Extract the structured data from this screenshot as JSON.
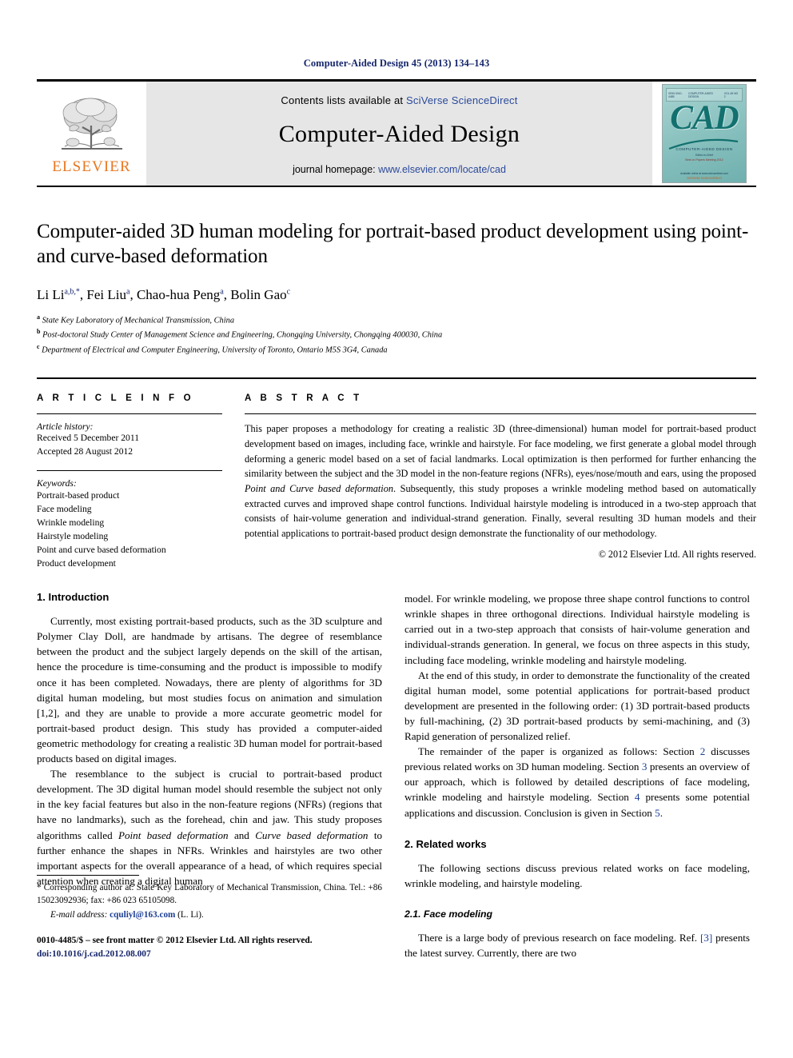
{
  "running_head": "Computer-Aided Design 45 (2013) 134–143",
  "masthead": {
    "contents_prefix": "Contents lists available at ",
    "contents_link": "SciVerse ScienceDirect",
    "journal_title": "Computer-Aided Design",
    "homepage_prefix": "journal homepage: ",
    "homepage_link": "www.elsevier.com/locate/cad",
    "publisher_logo_text": "ELSEVIER",
    "cover": {
      "title": "CAD",
      "top_left": "ISSN 0010-4485",
      "top_center": "COMPUTER-AIDED DESIGN",
      "top_right": "VOL 45 NO 2",
      "sub1": "COMPUTER-AIDED  DESIGN",
      "sub2": "Editor-in-Chief",
      "sub3": "Best on Papers Meeting 2012",
      "foot1": "Available online at www.sciencedirect.com",
      "foot2": "SciVerse ScienceDirect"
    }
  },
  "article": {
    "title": "Computer-aided 3D human modeling for portrait-based product development using point- and curve-based deformation",
    "authors": [
      {
        "name": "Li Li",
        "sup": "a,b,*"
      },
      {
        "name": "Fei Liu",
        "sup": "a"
      },
      {
        "name": "Chao-hua Peng",
        "sup": "a"
      },
      {
        "name": "Bolin Gao",
        "sup": "c"
      }
    ],
    "affiliations": [
      {
        "marker": "a",
        "text": "State Key Laboratory of Mechanical Transmission, China"
      },
      {
        "marker": "b",
        "text": "Post-doctoral Study Center of Management Science and Engineering, Chongqing University, Chongqing 400030, China"
      },
      {
        "marker": "c",
        "text": "Department of Electrical and Computer Engineering, University of Toronto, Ontario M5S 3G4, Canada"
      }
    ]
  },
  "article_info": {
    "heading": "A R T I C L E   I N F O",
    "history_label": "Article history:",
    "history": [
      "Received 5 December 2011",
      "Accepted 28 August 2012"
    ],
    "keywords_label": "Keywords:",
    "keywords": [
      "Portrait-based product",
      "Face modeling",
      "Wrinkle modeling",
      "Hairstyle modeling",
      "Point and curve based deformation",
      "Product development"
    ]
  },
  "abstract": {
    "heading": "A B S T R A C T",
    "part1": "This paper proposes a methodology for creating a realistic 3D (three-dimensional) human model for portrait-based product development based on images, including face, wrinkle and hairstyle. For face modeling, we first generate a global model through deforming a generic model based on a set of facial landmarks. Local optimization is then performed for further enhancing the similarity between the subject and the 3D model in the non-feature regions (NFRs), eyes/nose/mouth and ears, using the proposed ",
    "italic1": "Point and Curve based deformation",
    "part2": ". Subsequently, this study proposes a wrinkle modeling method based on automatically extracted curves and improved shape control functions. Individual hairstyle modeling is introduced in a two-step approach that consists of hair-volume generation and individual-strand generation. Finally, several resulting 3D human models and their potential applications to portrait-based product design demonstrate the functionality of our methodology.",
    "copyright": "© 2012 Elsevier Ltd. All rights reserved."
  },
  "body": {
    "left": {
      "h_intro": "1. Introduction",
      "p1": "Currently, most existing portrait-based products, such as the 3D sculpture and Polymer Clay Doll, are handmade by artisans. The degree of resemblance between the product and the subject largely depends on the skill of the artisan, hence the procedure is time-consuming and the product is impossible to modify once it has been completed. Nowadays, there are plenty of algorithms for 3D digital human modeling, but most studies focus on animation and simulation [1,2], and they are unable to provide a more accurate geometric model for portrait-based product design. This study has provided a computer-aided geometric methodology for creating a realistic 3D human model for portrait-based products based on digital images.",
      "p1_ref": "[1,2]",
      "p2_a": "The resemblance to the subject is crucial to portrait-based product development. The 3D digital human model should resemble the subject not only in the key facial features but also in the non-feature regions (NFRs) (regions that have no landmarks), such as the forehead, chin and jaw. This study proposes algorithms called ",
      "p2_i1": "Point based deformation",
      "p2_b": " and ",
      "p2_i2": "Curve based deformation",
      "p2_c": " to further enhance the shapes in NFRs. Wrinkles and hairstyles are two other important aspects for the overall appearance of a head, of which requires special attention when creating a digital human"
    },
    "right": {
      "p3": "model. For wrinkle modeling, we propose three shape control functions to control wrinkle shapes in three orthogonal directions. Individual hairstyle modeling is carried out in a two-step approach that consists of hair-volume generation and individual-strands generation. In general, we focus on three aspects in this study, including face modeling, wrinkle modeling and hairstyle modeling.",
      "p4": "At the end of this study, in order to demonstrate the functionality of the created digital human model, some potential applications for portrait-based product development are presented in the following order: (1) 3D portrait-based products by full-machining, (2) 3D portrait-based products by semi-machining, and (3) Rapid generation of personalized relief.",
      "p5_a": "The remainder of the paper is organized as follows: Section ",
      "p5_r1": "2",
      "p5_b": " discusses previous related works on 3D human modeling. Section ",
      "p5_r2": "3",
      "p5_c": " presents an overview of our approach, which is followed by detailed descriptions of face modeling, wrinkle modeling and hairstyle modeling. Section ",
      "p5_r3": "4",
      "p5_d": " presents some potential applications and discussion. Conclusion is given in Section ",
      "p5_r4": "5",
      "p5_e": ".",
      "h_related": "2. Related works",
      "p6": "The following sections discuss previous related works on face modeling, wrinkle modeling, and hairstyle modeling.",
      "h_face": "2.1. Face modeling",
      "p7_a": "There is a large body of previous research on face modeling. Ref. ",
      "p7_r": "[3]",
      "p7_b": " presents the latest survey. Currently, there are two"
    }
  },
  "footnote": {
    "star": "*",
    "corresponding": " Corresponding author at: State Key Laboratory of Mechanical Transmission, China. Tel.: +86 15023092936; fax: +86 023 65105098.",
    "email_label": "E-mail address:",
    "email": "cquliyl@163.com",
    "email_owner": " (L. Li).",
    "issn": "0010-4485/$ – see front matter © 2012 Elsevier Ltd. All rights reserved.",
    "doi": "doi:10.1016/j.cad.2012.08.007"
  }
}
